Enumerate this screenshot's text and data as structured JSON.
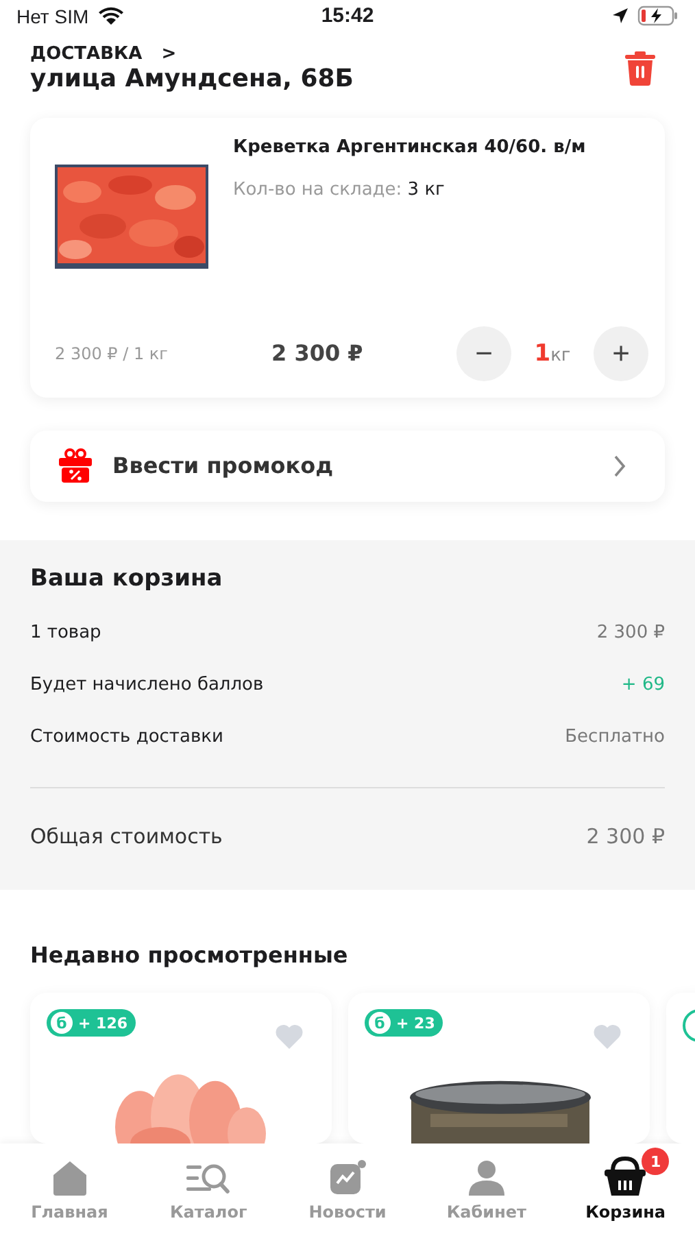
{
  "status_bar": {
    "carrier": "Нет SIM",
    "time": "15:42"
  },
  "delivery": {
    "label": "ДОСТАВКА",
    "chevron": ">",
    "address": "улица Амундсена, 68Б"
  },
  "cart_item": {
    "name": "Креветка Аргентинская 40/60. в/м",
    "stock_label": "Кол-во на складе:",
    "stock_value": "3 кг",
    "unit_price": "2 300 ₽ / 1 кг",
    "total": "2 300 ₽",
    "minus": "−",
    "plus": "+",
    "quantity": "1",
    "unit": "кг"
  },
  "promo": {
    "label": "Ввести промокод"
  },
  "summary": {
    "title": "Ваша корзина",
    "rows": [
      {
        "label": "1 товар",
        "value": "2 300 ₽",
        "kind": "plain"
      },
      {
        "label": "Будет начислено баллов",
        "value": "+ 69",
        "kind": "bonus"
      },
      {
        "label": "Стоимость доставки",
        "value": "Бесплатно",
        "kind": "muted"
      }
    ],
    "total_label": "Общая стоимость",
    "total_value": "2 300 ₽"
  },
  "recent": {
    "title": "Недавно просмотренные",
    "items": [
      {
        "bonus_sign": "б",
        "bonus": "+ 126",
        "favorite": false,
        "kind": "picture"
      },
      {
        "bonus_sign": "б",
        "bonus": "+ 23",
        "favorite": false,
        "kind": "picture"
      },
      {
        "kind": "partial"
      }
    ]
  },
  "tabs": [
    {
      "label": "Главная",
      "selected": false
    },
    {
      "label": "Каталог",
      "selected": false
    },
    {
      "label": "Новости",
      "selected": false
    },
    {
      "label": "Кабинет",
      "selected": false
    },
    {
      "label": "Корзина",
      "selected": true,
      "badge": "1"
    }
  ]
}
